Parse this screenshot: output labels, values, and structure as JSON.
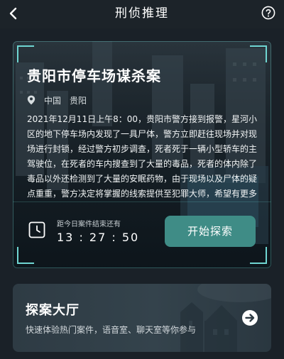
{
  "header": {
    "title": "刑侦推理",
    "back_icon": "chevron-left-icon",
    "help_icon": "question-circle-icon"
  },
  "case": {
    "title": "贵阳市停车场谋杀案",
    "location_icon": "map-pin-icon",
    "country": "中国",
    "city": "贵阳",
    "description": "2021年12月11日上午8：00，贵阳市警方接到报警，星河小区的地下停车场内发现了一具尸体，警方立即赶往现场并对现场进行封锁，经过警方初步调查，死者死于一辆小型轿车的主驾驶位，在死者的车内搜查到了大量的毒品，死者的体内除了毒品以外还检测到了大量的安眠药物，由于现场以及尸体的疑点重重，警方决定将掌握的线索提供至犯罪大师，希望有更多侦探协助警方侦破案件。",
    "countdown_label": "距今日案件结束还有",
    "countdown_time": "13 : 27 : 50",
    "clock_icon": "clock-icon",
    "start_label": "开始探索",
    "accent_color": "#6fd6d2",
    "button_color": "#3f8c86"
  },
  "hall": {
    "title": "探案大厅",
    "subtitle": "快速体验热门案件，语音室、聊天室等你参与",
    "arrow_icon": "arrow-right-circle-icon"
  }
}
